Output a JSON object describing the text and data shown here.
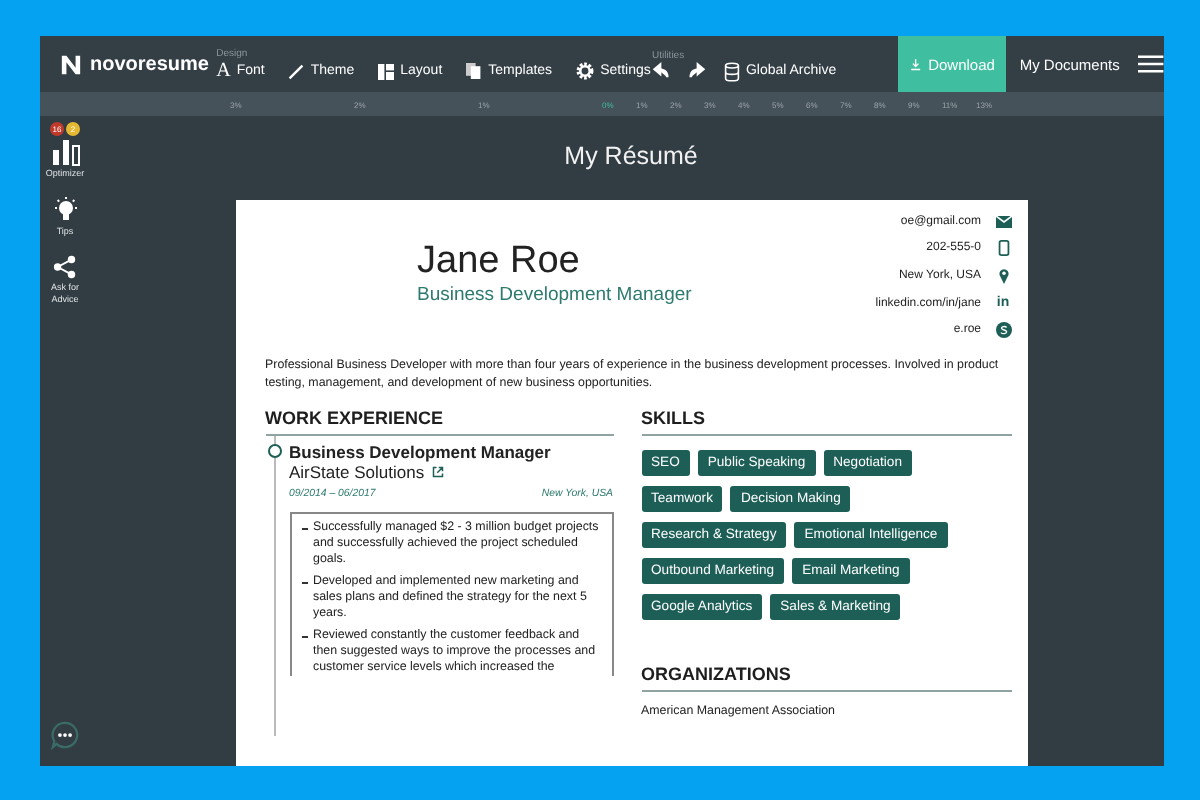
{
  "app": {
    "logo": "novoresume",
    "design_label": "Design",
    "design_tools": [
      {
        "kind": "font",
        "glyph": "A",
        "label": "Font"
      },
      {
        "kind": "theme",
        "label": "Theme"
      },
      {
        "kind": "layout",
        "label": "Layout"
      },
      {
        "kind": "templates",
        "label": "Templates"
      },
      {
        "kind": "settings",
        "label": "Settings"
      }
    ],
    "utilities_label": "Utilities",
    "utility_tools": [
      {
        "kind": "undo"
      },
      {
        "kind": "redo"
      },
      {
        "kind": "archive",
        "label": "Global Archive"
      }
    ],
    "download": "Download",
    "my_documents": "My Documents"
  },
  "ruler": [
    {
      "label": "3%",
      "selected": false
    },
    {
      "label": "2%",
      "selected": false
    },
    {
      "label": "1%",
      "selected": false
    },
    {
      "label": "0%",
      "selected": true
    },
    {
      "label": "1%",
      "selected": false
    },
    {
      "label": "2%",
      "selected": false
    },
    {
      "label": "3%",
      "selected": false
    },
    {
      "label": "4%",
      "selected": false
    },
    {
      "label": "5%",
      "selected": false
    },
    {
      "label": "6%",
      "selected": false
    },
    {
      "label": "7%",
      "selected": false
    },
    {
      "label": "8%",
      "selected": false
    },
    {
      "label": "9%",
      "selected": false
    },
    {
      "label": "11%",
      "selected": false
    },
    {
      "label": "13%",
      "selected": false
    }
  ],
  "sidebar": [
    {
      "kind": "optimizer",
      "label": "Optimizer",
      "badges": [
        {
          "text": "16",
          "color": "#c0392b"
        },
        {
          "text": "2",
          "color": "#e5b832"
        }
      ]
    },
    {
      "kind": "tips",
      "label": "Tips"
    },
    {
      "kind": "advice",
      "label": "Ask for Advice"
    }
  ],
  "page_title": "My Résumé",
  "resume": {
    "name": "Jane Roe",
    "title": "Business Development Manager",
    "contacts": [
      {
        "kind": "email",
        "text": "oe@gmail.com"
      },
      {
        "kind": "phone",
        "text": "202-555-0"
      },
      {
        "kind": "location",
        "text": "New York, USA"
      },
      {
        "kind": "linkedin",
        "text": "linkedin.com/in/jane",
        "glyph": "in"
      },
      {
        "kind": "skype",
        "text": "e.roe"
      }
    ],
    "summary": "Professional Business Developer with more than four years of experience in the business development processes. Involved in product testing, management, and development of new business opportunities.",
    "work_heading": "WORK EXPERIENCE",
    "jobs": [
      {
        "role": "Business Development Manager",
        "company": "AirState Solutions",
        "dates": "09/2014 – 06/2017",
        "location": "New York, USA",
        "bullets": [
          "Successfully managed $2 - 3 million budget projects and successfully achieved the project scheduled goals.",
          "Developed and implemented new marketing and sales plans and defined the strategy for the next 5 years.",
          "Reviewed constantly the customer feedback and then suggested ways to improve the processes and customer service levels which increased the"
        ]
      }
    ],
    "skills_heading": "SKILLS",
    "skills": [
      "SEO",
      "Public Speaking",
      "Negotiation",
      "Teamwork",
      "Decision Making",
      "Research & Strategy",
      "Emotional Intelligence",
      "Outbound Marketing",
      "Email Marketing",
      "Google Analytics",
      "Sales & Marketing"
    ],
    "org_heading": "ORGANIZATIONS",
    "organizations": [
      "American Management Association"
    ]
  }
}
